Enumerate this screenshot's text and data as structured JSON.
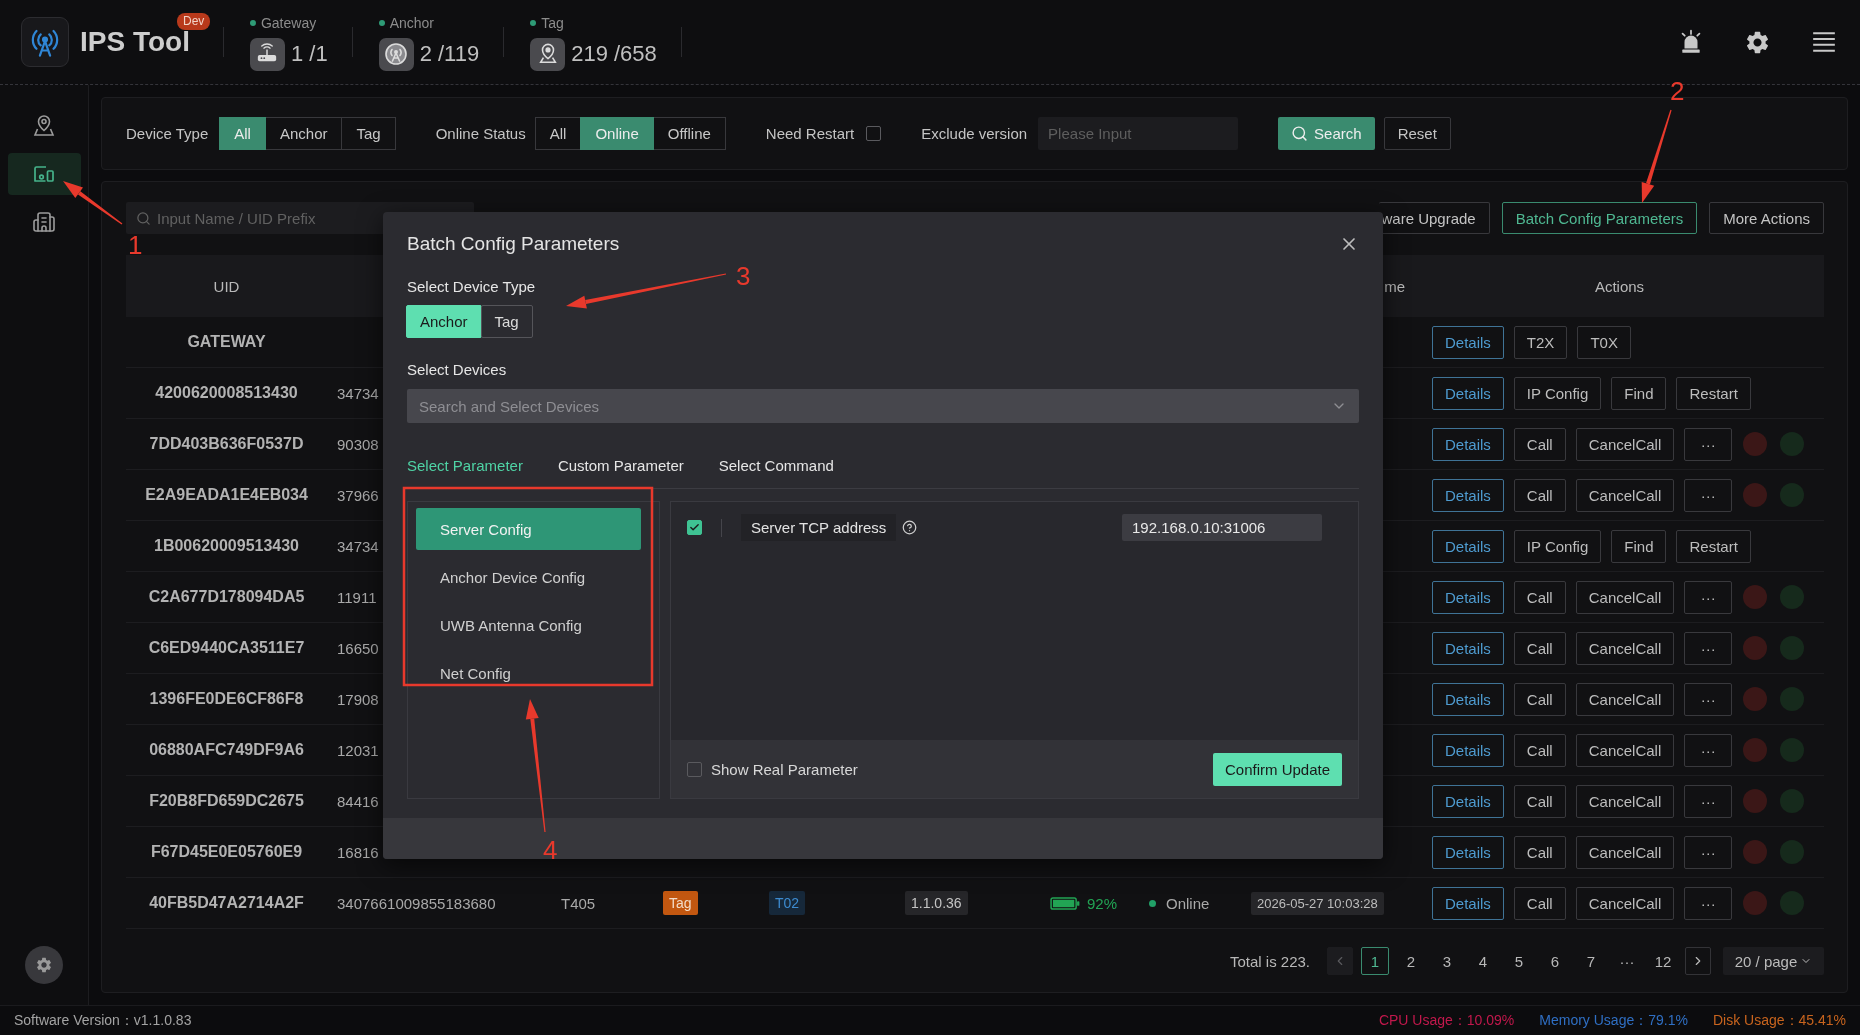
{
  "app": {
    "title": "IPS Tool",
    "badge": "Dev"
  },
  "stats": [
    {
      "label": "Gateway",
      "value": "1 /1"
    },
    {
      "label": "Anchor",
      "value": "2 /119"
    },
    {
      "label": "Tag",
      "value": "219 /658"
    }
  ],
  "sidebar": {
    "items": [
      {
        "selected": false
      },
      {
        "selected": true
      },
      {
        "selected": false
      }
    ]
  },
  "filters": {
    "device_type": {
      "label": "Device Type",
      "options": [
        {
          "label": "All",
          "selected": true
        },
        {
          "label": "Anchor",
          "selected": false
        },
        {
          "label": "Tag",
          "selected": false
        }
      ]
    },
    "online_status": {
      "label": "Online Status",
      "options": [
        {
          "label": "All",
          "selected": false
        },
        {
          "label": "Online",
          "selected": true
        },
        {
          "label": "Offline",
          "selected": false
        }
      ]
    },
    "need_restart": {
      "label": "Need Restart",
      "checked": false
    },
    "exclude_version": {
      "label": "Exclude version",
      "placeholder": "Please Input"
    },
    "search_button": "Search",
    "reset_button": "Reset"
  },
  "toolbar": {
    "search": {
      "placeholder": "Input Name / UID Prefix"
    },
    "actions": [
      {
        "label": "ware Upgrade",
        "active": false
      },
      {
        "label": "Batch Config Parameters",
        "active": true
      },
      {
        "label": "More Actions",
        "active": false
      }
    ]
  },
  "table": {
    "header": {
      "column_1": "UID",
      "column_9": "me",
      "column_10": "Actions"
    },
    "rows": [
      {
        "column_1": "GATEWAY",
        "actions": [
          {
            "label": "Details",
            "kind": "primary"
          },
          {
            "label": "T2X",
            "kind": "default"
          },
          {
            "label": "T0X",
            "kind": "default"
          }
        ]
      },
      {
        "column_1": "4200620008513430",
        "column_2": "34734",
        "actions": [
          {
            "label": "Details",
            "kind": "primary"
          },
          {
            "label": "IP Config",
            "kind": "default"
          },
          {
            "label": "Find",
            "kind": "default"
          },
          {
            "label": "Restart",
            "kind": "default"
          }
        ]
      },
      {
        "column_1": "7DD403B636F0537D",
        "column_2": "90308",
        "actions": [
          {
            "label": "Details",
            "kind": "primary"
          },
          {
            "label": "Call",
            "kind": "default"
          },
          {
            "label": "CancelCall",
            "kind": "default"
          },
          {
            "label": "···",
            "kind": "default"
          }
        ],
        "lights": [
          {
            "color": "#3b1717"
          },
          {
            "color": "#162a1c"
          }
        ]
      },
      {
        "column_1": "E2A9EADA1E4EB034",
        "column_2": "37966",
        "actions": [
          {
            "label": "Details",
            "kind": "primary"
          },
          {
            "label": "Call",
            "kind": "default"
          },
          {
            "label": "CancelCall",
            "kind": "default"
          },
          {
            "label": "···",
            "kind": "default"
          }
        ],
        "lights": [
          {
            "color": "#3b1717"
          },
          {
            "color": "#162a1c"
          }
        ]
      },
      {
        "column_1": "1B00620009513430",
        "column_2": "34734",
        "actions": [
          {
            "label": "Details",
            "kind": "primary"
          },
          {
            "label": "IP Config",
            "kind": "default"
          },
          {
            "label": "Find",
            "kind": "default"
          },
          {
            "label": "Restart",
            "kind": "default"
          }
        ]
      },
      {
        "column_1": "C2A677D178094DA5",
        "column_2": "11911",
        "actions": [
          {
            "label": "Details",
            "kind": "primary"
          },
          {
            "label": "Call",
            "kind": "default"
          },
          {
            "label": "CancelCall",
            "kind": "default"
          },
          {
            "label": "···",
            "kind": "default"
          }
        ],
        "lights": [
          {
            "color": "#3b1717"
          },
          {
            "color": "#162a1c"
          }
        ]
      },
      {
        "column_1": "C6ED9440CA3511E7",
        "column_2": "16650",
        "actions": [
          {
            "label": "Details",
            "kind": "primary"
          },
          {
            "label": "Call",
            "kind": "default"
          },
          {
            "label": "CancelCall",
            "kind": "default"
          },
          {
            "label": "···",
            "kind": "default"
          }
        ],
        "lights": [
          {
            "color": "#3b1717"
          },
          {
            "color": "#162a1c"
          }
        ]
      },
      {
        "column_1": "1396FE0DE6CF86F8",
        "column_2": "17908",
        "actions": [
          {
            "label": "Details",
            "kind": "primary"
          },
          {
            "label": "Call",
            "kind": "default"
          },
          {
            "label": "CancelCall",
            "kind": "default"
          },
          {
            "label": "···",
            "kind": "default"
          }
        ],
        "lights": [
          {
            "color": "#3b1717"
          },
          {
            "color": "#162a1c"
          }
        ]
      },
      {
        "column_1": "06880AFC749DF9A6",
        "column_2": "12031",
        "actions": [
          {
            "label": "Details",
            "kind": "primary"
          },
          {
            "label": "Call",
            "kind": "default"
          },
          {
            "label": "CancelCall",
            "kind": "default"
          },
          {
            "label": "···",
            "kind": "default"
          }
        ],
        "lights": [
          {
            "color": "#3b1717"
          },
          {
            "color": "#162a1c"
          }
        ]
      },
      {
        "column_1": "F20B8FD659DC2675",
        "column_2": "84416",
        "actions": [
          {
            "label": "Details",
            "kind": "primary"
          },
          {
            "label": "Call",
            "kind": "default"
          },
          {
            "label": "CancelCall",
            "kind": "default"
          },
          {
            "label": "···",
            "kind": "default"
          }
        ],
        "lights": [
          {
            "color": "#3b1717"
          },
          {
            "color": "#162a1c"
          }
        ]
      },
      {
        "column_1": "F67D45E0E05760E9",
        "column_2": "16816",
        "actions": [
          {
            "label": "Details",
            "kind": "primary"
          },
          {
            "label": "Call",
            "kind": "default"
          },
          {
            "label": "CancelCall",
            "kind": "default"
          },
          {
            "label": "···",
            "kind": "default"
          }
        ],
        "lights": [
          {
            "color": "#3b1717"
          },
          {
            "color": "#162a1c"
          }
        ]
      },
      {
        "column_1": "40FB5D47A2714A2F",
        "column_2": "3407661009855183680",
        "column_3": "T405",
        "column_4": "Tag",
        "column_5": "T02",
        "column_6": "1.1.0.36",
        "column_7": "92%",
        "column_8": {
          "label": "Online",
          "online": true
        },
        "column_9": "2026-05-27 10:03:28",
        "actions": [
          {
            "label": "Details",
            "kind": "primary"
          },
          {
            "label": "Call",
            "kind": "default"
          },
          {
            "label": "CancelCall",
            "kind": "default"
          },
          {
            "label": "···",
            "kind": "default"
          }
        ],
        "lights": [
          {
            "color": "#3b1717"
          },
          {
            "color": "#162a1c"
          }
        ]
      }
    ]
  },
  "pagination": {
    "total": "Total is 223.",
    "pages": [
      {
        "label": "1",
        "selected": true
      },
      {
        "label": "2",
        "selected": false
      },
      {
        "label": "3",
        "selected": false
      },
      {
        "label": "4",
        "selected": false
      },
      {
        "label": "5",
        "selected": false
      },
      {
        "label": "6",
        "selected": false
      },
      {
        "label": "7",
        "selected": false
      },
      {
        "label": "···",
        "selected": false
      },
      {
        "label": "12",
        "selected": false
      }
    ],
    "page_size": "20 / page"
  },
  "dialog": {
    "title": "Batch Config Parameters",
    "device_type": {
      "label": "Select Device Type",
      "options": [
        {
          "label": "Anchor",
          "selected": true
        },
        {
          "label": "Tag",
          "selected": false
        }
      ]
    },
    "devices": {
      "label": "Select Devices",
      "placeholder": "Search and Select Devices"
    },
    "tabs": [
      {
        "label": "Select Parameter",
        "selected": true
      },
      {
        "label": "Custom Parameter",
        "selected": false
      },
      {
        "label": "Select Command",
        "selected": false
      }
    ],
    "groups": [
      {
        "label": "Server Config",
        "selected": true
      },
      {
        "label": "Anchor Device Config",
        "selected": false
      },
      {
        "label": "UWB Antenna Config",
        "selected": false
      },
      {
        "label": "Net Config",
        "selected": false
      }
    ],
    "parameters": [
      {
        "label": "Server TCP address",
        "checked": true,
        "value": "192.168.0.10:31006"
      }
    ],
    "show_real": {
      "label": "Show Real Parameter",
      "checked": false
    },
    "confirm_button": "Confirm Update"
  },
  "annotations": [
    {
      "label": "1"
    },
    {
      "label": "2"
    },
    {
      "label": "3"
    },
    {
      "label": "4"
    }
  ],
  "status_bar": {
    "version": "Software Version：v1.1.0.83",
    "usage": [
      {
        "label": "CPU Usage：10.09%",
        "color": "#c2184c"
      },
      {
        "label": "Memory Usage：79.1%",
        "color": "#2f6fc4"
      },
      {
        "label": "Disk Usage：45.41%",
        "color": "#c8641e"
      }
    ]
  }
}
